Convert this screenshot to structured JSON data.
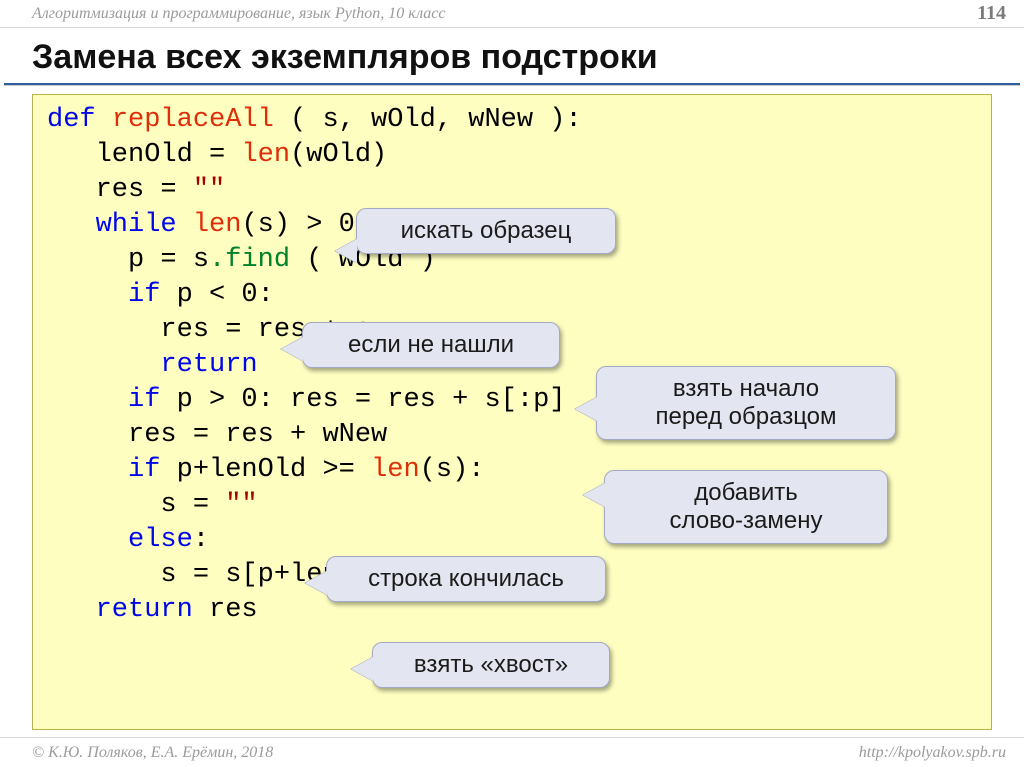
{
  "header": {
    "course": "Алгоритмизация и программирование, язык Python, 10 класс",
    "page": "114"
  },
  "title": "Замена всех экземпляров подстроки",
  "code": {
    "l1_def": "def",
    "l1_fn": "replaceAll",
    "l1_rest": " ( s, wOld, wNew ):",
    "l2a": "   lenOld = ",
    "l2_len": "len",
    "l2b": "(wOld)",
    "l3a": "   res = ",
    "l3_str": "\"\"",
    "l4a": "   ",
    "l4_while": "while",
    "l4b": " ",
    "l4_len": "len",
    "l4c": "(s) > 0:",
    "l5a": "     p = s",
    "l5_find": ".find",
    "l5b": " ( wOld )",
    "l6a": "     ",
    "l6_if": "if",
    "l6b": " p < 0:",
    "l7": "       res = res + s",
    "l8a": "       ",
    "l8_ret": "return",
    "l9a": "     ",
    "l9_if": "if",
    "l9b": " p > 0: res = res + s[:p]",
    "l10": "     res = res + wNew",
    "l11a": "     ",
    "l11_if": "if",
    "l11b": " p+lenOld >= ",
    "l11_len": "len",
    "l11c": "(s):",
    "l12a": "       s = ",
    "l12_str": "\"\"",
    "l13a": "     ",
    "l13_else": "else",
    "l13b": ":",
    "l14": "       s = s[p+lenOld:]",
    "l15a": "   ",
    "l15_ret": "return",
    "l15b": " res"
  },
  "callouts": {
    "c1": "искать образец",
    "c2": "если не нашли",
    "c3": "взять начало\nперед образцом",
    "c4": "добавить\nслово-замену",
    "c5": "строка кончилась",
    "c6": "взять «хвост»"
  },
  "footer": {
    "left": "© К.Ю. Поляков, Е.А. Ерёмин, 2018",
    "right": "http://kpolyakov.spb.ru"
  }
}
